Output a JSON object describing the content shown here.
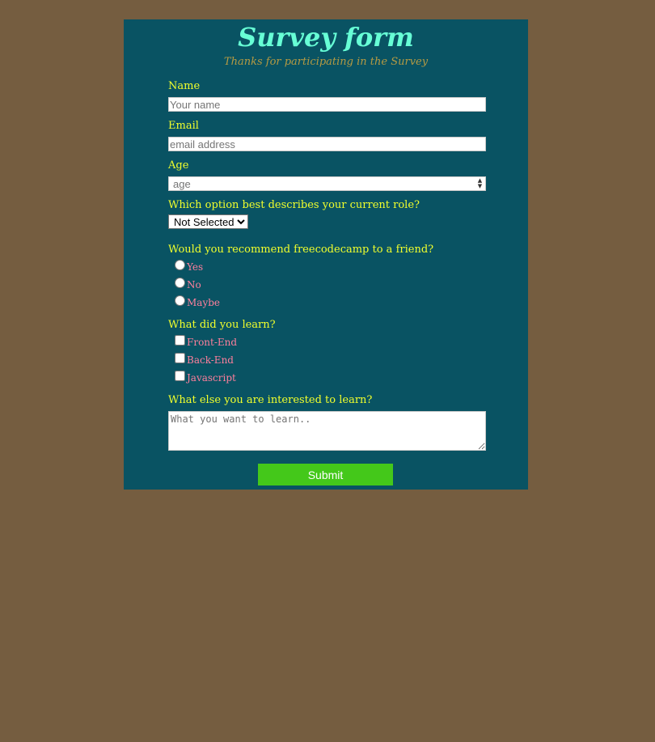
{
  "header": {
    "title": "Survey form",
    "subtitle": "Thanks for participating in the Survey"
  },
  "fields": {
    "name": {
      "label": "Name",
      "placeholder": "Your name"
    },
    "email": {
      "label": "Email",
      "placeholder": "email address"
    },
    "age": {
      "label": "Age",
      "placeholder": "age"
    }
  },
  "role": {
    "question": "Which option best describes your current role?",
    "selected": "Not Selected"
  },
  "recommend": {
    "question": "Would you recommend freecodecamp to a friend?",
    "options": [
      "Yes",
      "No",
      "Maybe"
    ]
  },
  "learned": {
    "question": "What did you learn?",
    "options": [
      "Front-End",
      "Back-End",
      "Javascript"
    ]
  },
  "interest": {
    "question": "What else you are interested to learn?",
    "placeholder": "What you want to learn.."
  },
  "submit_label": "Submit",
  "colors": {
    "page_bg": "#755d40",
    "card_bg": "#095363",
    "title": "#67ffd6",
    "label": "#f1ff2c",
    "option_text": "#ff7f9c",
    "submit_bg": "#44c81a"
  }
}
